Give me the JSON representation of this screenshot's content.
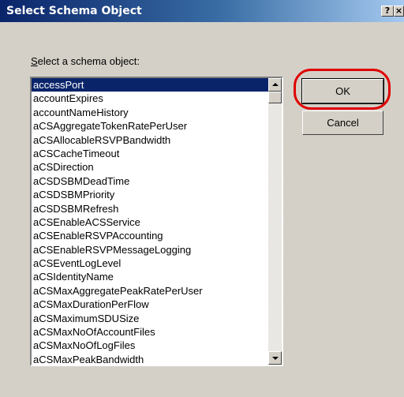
{
  "window": {
    "title": "Select Schema Object",
    "help_label": "?",
    "close_label": "×"
  },
  "prompt": {
    "accelerator": "S",
    "rest": "elect a schema object:"
  },
  "list": {
    "selected_index": 0,
    "items": [
      "accessPort",
      "accountExpires",
      "accountNameHistory",
      "aCSAggregateTokenRatePerUser",
      "aCSAllocableRSVPBandwidth",
      "aCSCacheTimeout",
      "aCSDirection",
      "aCSDSBMDeadTime",
      "aCSDSBMPriority",
      "aCSDSBMRefresh",
      "aCSEnableACSService",
      "aCSEnableRSVPAccounting",
      "aCSEnableRSVPMessageLogging",
      "aCSEventLogLevel",
      "aCSIdentityName",
      "aCSMaxAggregatePeakRatePerUser",
      "aCSMaxDurationPerFlow",
      "aCSMaximumSDUSize",
      "aCSMaxNoOfAccountFiles",
      "aCSMaxNoOfLogFiles",
      "aCSMaxPeakBandwidth"
    ]
  },
  "buttons": {
    "ok": "OK",
    "cancel": "Cancel"
  },
  "colors": {
    "selection": "#0a246a",
    "highlight_ring": "#e00000",
    "face": "#d4d0c8"
  }
}
